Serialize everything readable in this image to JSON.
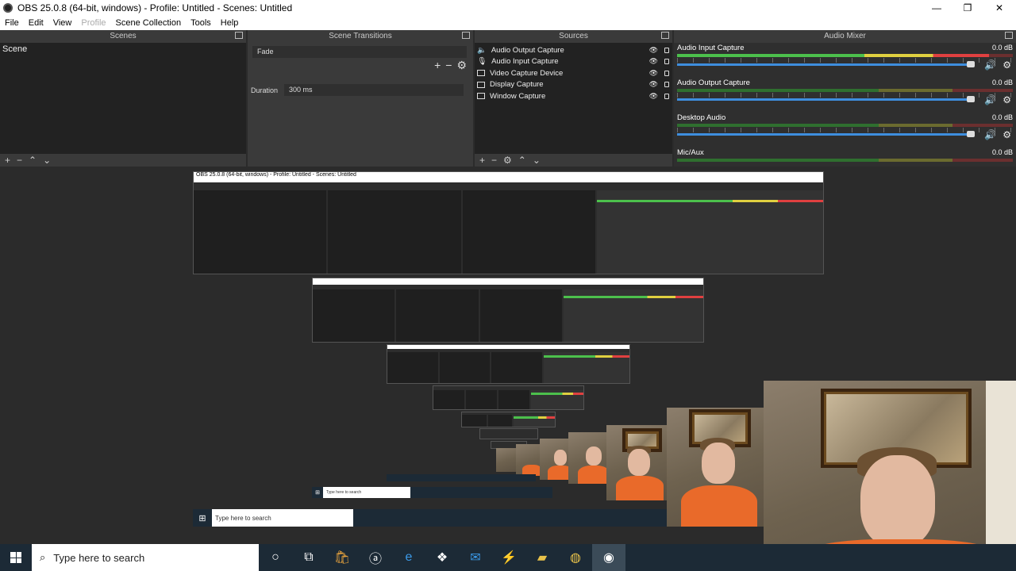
{
  "window": {
    "title": "OBS 25.0.8 (64-bit, windows) - Profile: Untitled - Scenes: Untitled",
    "minimize": "—",
    "restore": "❐",
    "close": "✕"
  },
  "menu": {
    "file": "File",
    "edit": "Edit",
    "view": "View",
    "profile": "Profile",
    "scene_collection": "Scene Collection",
    "tools": "Tools",
    "help": "Help"
  },
  "scenes": {
    "title": "Scenes",
    "items": [
      "Scene"
    ]
  },
  "transitions": {
    "title": "Scene Transitions",
    "selected": "Fade",
    "duration_label": "Duration",
    "duration_value": "300 ms"
  },
  "sources": {
    "title": "Sources",
    "items": [
      "Audio Output Capture",
      "Audio Input Capture",
      "Video Capture Device",
      "Display Capture",
      "Window Capture"
    ]
  },
  "mixer": {
    "title": "Audio Mixer",
    "tracks": [
      {
        "name": "Audio Input Capture",
        "db": "0.0 dB",
        "level": 0.93
      },
      {
        "name": "Audio Output Capture",
        "db": "0.0 dB",
        "level": 0.0
      },
      {
        "name": "Desktop Audio",
        "db": "0.0 dB",
        "level": 0.0
      },
      {
        "name": "Mic/Aux",
        "db": "0.0 dB",
        "level": 0.0
      }
    ]
  },
  "taskbar": {
    "search_placeholder": "Type here to search",
    "mini_search_placeholder": "Type here to search",
    "tiny_search_placeholder": "Type here to search"
  },
  "icons": {
    "toolbar": [
      "plus-icon",
      "minus-icon",
      "gear-icon",
      "arrow-up-icon",
      "arrow-down-icon"
    ],
    "taskbar": [
      "cortana-icon",
      "task-view-icon",
      "store-icon",
      "amazon-icon",
      "edge-icon",
      "dropbox-icon",
      "mail-icon",
      "visual-studio-icon",
      "file-explorer-icon",
      "chrome-icon",
      "obs-icon"
    ]
  },
  "colors": {
    "panel_bg": "#222222",
    "dock_bg": "#3a3a3a",
    "fader_blue": "#3e8ede",
    "meter_green": "#4cc04c",
    "meter_yellow": "#e0d040",
    "meter_red": "#e04040",
    "taskbar_bg": "#1c2a36"
  }
}
